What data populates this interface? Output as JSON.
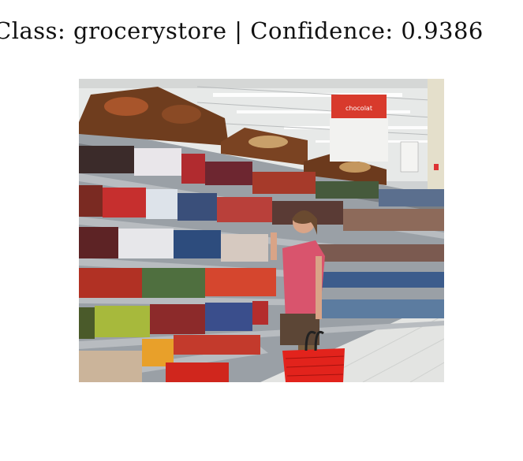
{
  "caption": {
    "text": "Class: grocerystore | Confidence: 0.9386"
  },
  "photo": {
    "sign_text": "chocolat",
    "colors": {
      "ceiling": "#e7e9e8",
      "shelf": "#b8bcc0",
      "floor": "#e3e4e2",
      "sign_red": "#d83a2c",
      "shirt": "#d9546d",
      "basket": "#e2231c"
    }
  }
}
